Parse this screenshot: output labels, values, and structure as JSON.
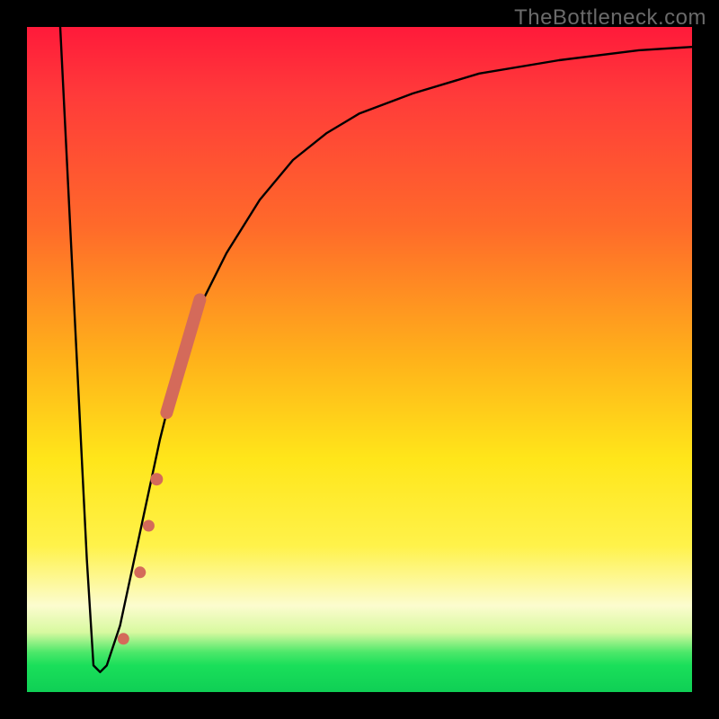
{
  "watermark": "TheBottleneck.com",
  "chart_data": {
    "type": "line",
    "title": "",
    "xlabel": "",
    "ylabel": "",
    "xlim": [
      0,
      100
    ],
    "ylim": [
      0,
      100
    ],
    "background_gradient": {
      "top": "#ff1a3a",
      "upper_mid": "#ffb21a",
      "mid": "#ffe61a",
      "lower_mid": "#fcfccf",
      "bottom": "#0fcf55"
    },
    "series": [
      {
        "name": "bottleneck-curve",
        "color": "#000000",
        "x": [
          5,
          7,
          9,
          10,
          11,
          12,
          14,
          17,
          20,
          23,
          26,
          30,
          35,
          40,
          45,
          50,
          58,
          68,
          80,
          92,
          100
        ],
        "y": [
          100,
          60,
          20,
          4,
          3,
          4,
          10,
          24,
          38,
          50,
          58,
          66,
          74,
          80,
          84,
          87,
          90,
          93,
          95,
          96.5,
          97
        ]
      }
    ],
    "highlight_points": {
      "name": "marked-segment",
      "color": "#d46a5a",
      "segment": {
        "x": [
          21,
          26
        ],
        "y": [
          42,
          59
        ]
      },
      "dots": [
        {
          "x": 19.5,
          "y": 32
        },
        {
          "x": 18.3,
          "y": 25
        },
        {
          "x": 17.0,
          "y": 18
        },
        {
          "x": 14.5,
          "y": 8
        }
      ]
    }
  }
}
